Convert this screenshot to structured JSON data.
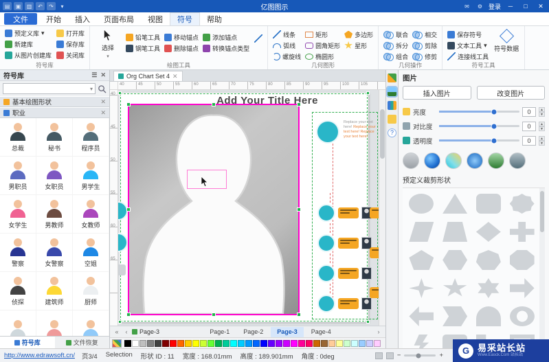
{
  "titlebar": {
    "title": "亿图图示",
    "login_label": "登录",
    "quick_icons": [
      "menu-icon",
      "save-icon",
      "print-icon",
      "undo-icon",
      "redo-icon",
      "customize-icon"
    ],
    "window_buttons": {
      "minimize": "─",
      "maximize": "□",
      "close": "✕"
    }
  },
  "ribbon": {
    "tabs": [
      {
        "label": "文件"
      },
      {
        "label": "开始"
      },
      {
        "label": "插入"
      },
      {
        "label": "页面布局"
      },
      {
        "label": "视图"
      },
      {
        "label": "符号"
      },
      {
        "label": "帮助"
      }
    ],
    "active_tab": "符号",
    "groups": {
      "library": {
        "label": "符号库",
        "buttons": [
          {
            "label": "预定义库",
            "icon": "library-icon"
          },
          {
            "label": "打开库",
            "icon": "open-folder-icon"
          },
          {
            "label": "新建库",
            "icon": "new-library-icon"
          },
          {
            "label": "保存库",
            "icon": "save-library-icon"
          },
          {
            "label": "从图片创建库",
            "icon": "image-library-icon"
          },
          {
            "label": "关闭库",
            "icon": "close-library-icon"
          }
        ]
      },
      "draw": {
        "label": "绘图工具",
        "select_label": "选择",
        "buttons": [
          {
            "label": "铅笔工具",
            "icon": "pencil-icon"
          },
          {
            "label": "移动锚点",
            "icon": "move-anchor-icon"
          },
          {
            "label": "添加锚点",
            "icon": "add-anchor-icon"
          },
          {
            "label": "钢笔工具",
            "icon": "pen-icon"
          },
          {
            "label": "删除锚点",
            "icon": "delete-anchor-icon"
          },
          {
            "label": "转换锚点类型",
            "icon": "convert-anchor-icon"
          }
        ]
      },
      "shapes": {
        "label": "几何图形",
        "items": [
          "线条",
          "弧线",
          "螺旋线",
          "矩形",
          "圆角矩形",
          "椭圆形",
          "多边形",
          "星形"
        ]
      },
      "ops": {
        "label": "几何操作",
        "items": [
          "联合",
          "拆分",
          "组合",
          "相交",
          "剪除",
          "修剪"
        ]
      },
      "symtools": {
        "label": "符号工具",
        "items": [
          "保存符号",
          "文本工具",
          "连接线工具"
        ],
        "big_button": "符号数据"
      }
    }
  },
  "symbol_panel": {
    "title": "符号库",
    "search_value": "",
    "sections": [
      {
        "label": "基本绘图形状"
      },
      {
        "label": "职业"
      }
    ],
    "professions": [
      {
        "label": "总裁",
        "color": "#37474f"
      },
      {
        "label": "秘书",
        "color": "#455a64"
      },
      {
        "label": "程序员",
        "color": "#546e7a"
      },
      {
        "label": "男职员",
        "color": "#5c6bc0"
      },
      {
        "label": "女职员",
        "color": "#7e57c2"
      },
      {
        "label": "男学生",
        "color": "#29b6f6"
      },
      {
        "label": "女学生",
        "color": "#f06292"
      },
      {
        "label": "男教师",
        "color": "#6d4c41"
      },
      {
        "label": "女教师",
        "color": "#ab47bc"
      },
      {
        "label": "警察",
        "color": "#283593"
      },
      {
        "label": "女警察",
        "color": "#3949ab"
      },
      {
        "label": "空姐",
        "color": "#1e88e5"
      },
      {
        "label": "侦探",
        "color": "#424242"
      },
      {
        "label": "建筑师",
        "color": "#fdd835"
      },
      {
        "label": "厨师",
        "color": "#eceff1"
      },
      {
        "label": "",
        "color": "#cfd8dc"
      },
      {
        "label": "",
        "color": "#ef9a9a"
      },
      {
        "label": "",
        "color": "#90caf9"
      }
    ],
    "bottom_tabs": [
      "符号库",
      "文件恢复"
    ]
  },
  "canvas": {
    "doc_tab": "Org Chart Set 4",
    "title_text": "Add Your Title Here",
    "text_gray": "Replace your text here! ",
    "text_orange": "Replace your text here! Replace your text here!",
    "ruler_ticks": [
      "40",
      "45",
      "50",
      "55",
      "60",
      "65",
      "70",
      "75",
      "80",
      "85",
      "90",
      "95",
      "100",
      "105"
    ],
    "vruler_ticks": [
      "40",
      "45",
      "50",
      "55",
      "60",
      "65"
    ]
  },
  "pages": {
    "nav_label": "Page-3",
    "tabs": [
      "Page-1",
      "Page-2",
      "Page-3",
      "Page-4"
    ],
    "active": "Page-3"
  },
  "colors": [
    "#000000",
    "#ffffff",
    "#bfbfbf",
    "#808080",
    "#404040",
    "#7f0000",
    "#ff0000",
    "#ff6600",
    "#ffcc00",
    "#ffff00",
    "#ccff33",
    "#66ff33",
    "#00b050",
    "#00cc99",
    "#00ffff",
    "#00ccff",
    "#0099ff",
    "#0066ff",
    "#0000ff",
    "#6600ff",
    "#9900ff",
    "#cc00ff",
    "#ff00ff",
    "#ff0099",
    "#ff0066",
    "#cc6600",
    "#996633",
    "#ffcc99",
    "#ffff99",
    "#ccffcc",
    "#ccffff",
    "#99ccff",
    "#ccccff",
    "#ffccff"
  ],
  "picture_panel": {
    "title": "图片",
    "buttons": [
      "插入图片",
      "改变图片"
    ],
    "sliders": [
      {
        "label": "亮度",
        "value": "0",
        "icon": "brightness-icon"
      },
      {
        "label": "对比度",
        "value": "0",
        "icon": "contrast-icon"
      },
      {
        "label": "透明度",
        "value": "0",
        "icon": "transparency-icon"
      }
    ],
    "thumbs": [
      {
        "style": "portrait"
      },
      {
        "style": "earth"
      },
      {
        "style": "paint"
      },
      {
        "style": "blue"
      },
      {
        "style": "trees"
      },
      {
        "style": "city"
      }
    ],
    "crop_label": "预定义裁剪形状",
    "shapes": [
      "ellipse",
      "triangle",
      "rounded-rect",
      "seal",
      "parallelogram",
      "trapezoid",
      "diamond",
      "cross",
      "pentagon",
      "hexagon",
      "heptagon",
      "octagon",
      "star4",
      "star5",
      "star6",
      "arrow-right",
      "arrow-left",
      "chevron",
      "half-circle",
      "ring",
      "lightning",
      "callout",
      "l-shape",
      "frame"
    ]
  },
  "statusbar": {
    "link": "http://www.edrawsoft.cn/",
    "items": [
      "页3/4",
      "Selection",
      "形状 ID : 11",
      "宽度 : 168.01mm",
      "高度 : 189.901mm",
      "角度 : 0deg"
    ]
  },
  "watermark": {
    "title": "易采站长站",
    "subtitle": "Www.Easck.Com 站长站"
  }
}
